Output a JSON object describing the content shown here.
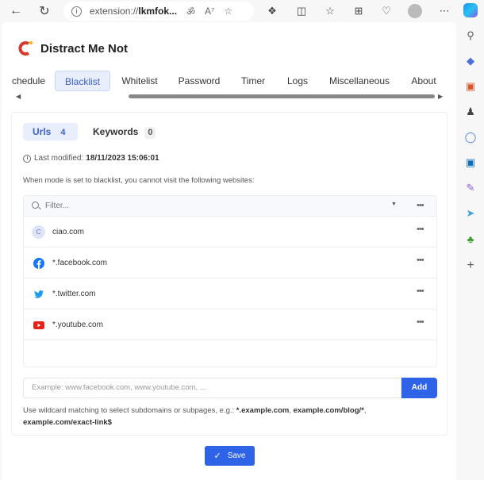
{
  "browser": {
    "url_prefix": "extension://",
    "url_bold": "lkmfok...",
    "toolbar_icons": [
      "back-icon",
      "refresh-icon",
      "read-aloud-icon",
      "reader-icon",
      "favorite-icon",
      "extensions-icon",
      "split-screen-icon",
      "favorites-icon",
      "collections-icon",
      "browser-essentials-icon",
      "profile-avatar",
      "more-icon",
      "copilot-icon"
    ],
    "sidebar_icons": [
      "search-icon",
      "shopping-icon",
      "tools-icon",
      "games-icon",
      "microsoft365-icon",
      "outlook-icon",
      "designer-icon",
      "telegram-icon",
      "tree-icon",
      "add-icon"
    ]
  },
  "app": {
    "title": "Distract Me Not",
    "tabs": [
      {
        "label": "chedule",
        "active": false
      },
      {
        "label": "Blacklist",
        "active": true
      },
      {
        "label": "Whitelist",
        "active": false
      },
      {
        "label": "Password",
        "active": false
      },
      {
        "label": "Timer",
        "active": false
      },
      {
        "label": "Logs",
        "active": false
      },
      {
        "label": "Miscellaneous",
        "active": false
      },
      {
        "label": "About",
        "active": false
      }
    ]
  },
  "blacklist": {
    "subtabs": [
      {
        "label": "Urls",
        "count": "4",
        "active": true
      },
      {
        "label": "Keywords",
        "count": "0",
        "active": false
      }
    ],
    "last_modified_label": "Last modified:",
    "last_modified_value": "18/11/2023 15:06:01",
    "description": "When mode is set to blacklist, you cannot visit the following websites:",
    "filter_placeholder": "Filter...",
    "more": "•••",
    "items": [
      {
        "name": "ciao.com",
        "icon": "letter-c",
        "letter": "C"
      },
      {
        "name": "*.facebook.com",
        "icon": "facebook-icon"
      },
      {
        "name": "*.twitter.com",
        "icon": "twitter-icon"
      },
      {
        "name": "*.youtube.com",
        "icon": "youtube-icon"
      }
    ],
    "add_placeholder": "Example: www.facebook.com, www.youtube.com, ...",
    "add_label": "Add",
    "hint_prefix": "Use wildcard matching to select subdomains or subpages, e.g.: ",
    "hint_ex1": "*.example.com",
    "hint_sep": ", ",
    "hint_ex2": "example.com/blog/*",
    "hint_sep2": ", ",
    "hint_ex3": "example.com/exact-link$",
    "save_label": "Save"
  },
  "colors": {
    "accent": "#2e63e8",
    "active_tab_bg": "#e8eefb",
    "active_tab_text": "#3d63c9"
  }
}
